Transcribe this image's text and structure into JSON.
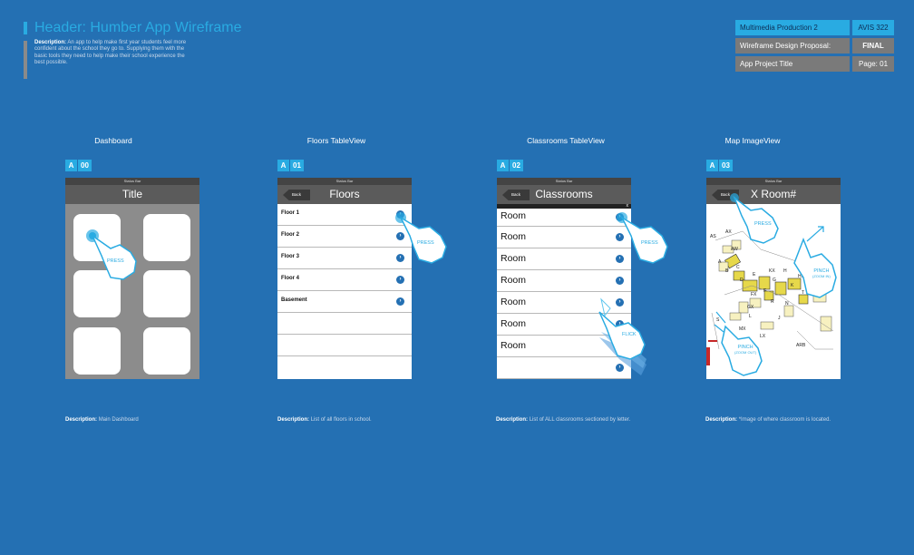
{
  "header": {
    "title": "Header: Humber App Wireframe",
    "desc_label": "Description:",
    "desc_text": "An app to help make first year students feel more confident about the school they go to. Supplying them with the basic tools they need to help make their school experience the best possible."
  },
  "info": {
    "course": "Multimedia Production 2",
    "code": "AVIS 322",
    "proposal": "Wireframe Design Proposal:",
    "status": "FINAL",
    "project": "App Project Title",
    "page": "Page: 01"
  },
  "screens": [
    {
      "label": "Dashboard",
      "tag_letter": "A",
      "tag_num": "00",
      "status": "Status Bar",
      "title": "Title",
      "gesture": "PRESS",
      "desc_label": "Description:",
      "desc": "Main Dashboard"
    },
    {
      "label": "Floors TableView",
      "tag_letter": "A",
      "tag_num": "01",
      "status": "Status Bar",
      "title": "Floors",
      "back": "Back",
      "gesture": "PRESS",
      "rows": [
        "Floor 1",
        "Floor 2",
        "Floor 3",
        "Floor 4",
        "Basement"
      ],
      "desc_label": "Description:",
      "desc": "List of all floors in school."
    },
    {
      "label": "Classrooms TableView",
      "tag_letter": "A",
      "tag_num": "02",
      "status": "Status Bar",
      "title": "Classrooms",
      "back": "Back",
      "gesture": "PRESS",
      "gesture2": "FLICK",
      "rows": [
        "Room",
        "Room",
        "Room",
        "Room",
        "Room",
        "Room",
        "Room"
      ],
      "desc_label": "Description:",
      "desc": "List of ALL classrooms sectioned by letter."
    },
    {
      "label": "Map ImageView",
      "tag_letter": "A",
      "tag_num": "03",
      "status": "Status Bar",
      "title": "X Room#",
      "back": "Back",
      "gesture": "PRESS",
      "gesture2": "PINCH",
      "gesture2_sub": "(ZOOM IN)",
      "gesture3": "PINCH",
      "gesture3_sub": "(ZOOM OUT)",
      "desc_label": "Description:",
      "desc": "*Image of where classroom is located.",
      "map_labels": [
        "AX",
        "AS",
        "AW",
        "A",
        "B",
        "C",
        "D",
        "E",
        "F",
        "G",
        "H",
        "K",
        "L",
        "LX",
        "MX",
        "N",
        "R",
        "S",
        "T",
        "J",
        "GX",
        "FX",
        "KX",
        "HX",
        "ARB"
      ]
    }
  ],
  "colors": {
    "background": "#2470b3",
    "accent": "#29abe2",
    "grey": "#7a7a7a",
    "navbar": "#5b5b5b"
  }
}
